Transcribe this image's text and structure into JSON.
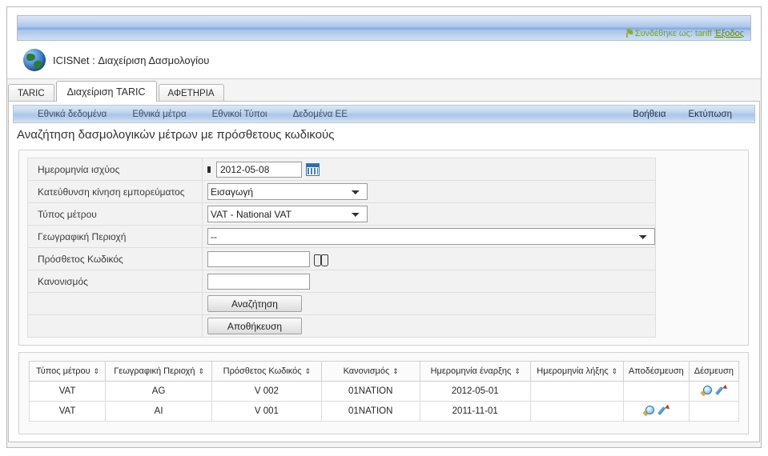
{
  "banner": {
    "login_text": "Συνδέθηκε ως: tariff",
    "logout_label": "Έξοδος",
    "app_title": "ICISNet : Διαχείριση Δασμολογίου",
    "logo_icon": "globe-icon",
    "leaf_icon": "leaf-icon"
  },
  "tabs": [
    {
      "label": "TARIC",
      "active": false
    },
    {
      "label": "Διαχείριση TARIC",
      "active": true
    },
    {
      "label": "ΑΦΕΤΗΡΙΑ",
      "active": false
    }
  ],
  "menu": {
    "left": [
      {
        "label": "Εθνικά δεδομένα"
      },
      {
        "label": "Εθνικά μέτρα"
      },
      {
        "label": "Εθνικοί Τύποι"
      },
      {
        "label": "Δεδομένα ΕΕ"
      }
    ],
    "right": [
      {
        "label": "Βοήθεια"
      },
      {
        "label": "Εκτύπωση"
      }
    ]
  },
  "page_title": "Αναζήτηση δασμολογικών μέτρων με πρόσθετους κωδικούς",
  "form": {
    "fields": [
      {
        "label": "Ημερομηνία ισχύος",
        "value": "2012-05-08",
        "required": true,
        "icon": "calendar-icon"
      },
      {
        "label": "Κατεύθυνση κίνηση εμπορεύματος",
        "value": "Εισαγωγή"
      },
      {
        "label": "Τύπος μέτρου",
        "value": "VAT - National VAT"
      },
      {
        "label": "Γεωγραφική Περιοχή",
        "value": "--"
      },
      {
        "label": "Πρόσθετος Κωδικός",
        "value": "",
        "icon": "binoculars-icon"
      },
      {
        "label": "Κανονισμός",
        "value": ""
      }
    ],
    "search_button": "Αναζήτηση",
    "save_button": "Αποθήκευση"
  },
  "results": {
    "columns": [
      {
        "label": "Τύπος μέτρου",
        "sortable": true
      },
      {
        "label": "Γεωγραφική Περιοχή",
        "sortable": true
      },
      {
        "label": "Πρόσθετος Κωδικός",
        "sortable": true
      },
      {
        "label": "Κανονισμός",
        "sortable": true
      },
      {
        "label": "Ημερομηνία έναρξης",
        "sortable": true
      },
      {
        "label": "Ημερομηνία λήξης",
        "sortable": true
      },
      {
        "label": "Αποδέσμευση",
        "sortable": false
      },
      {
        "label": "Δέσμευση",
        "sortable": false
      }
    ],
    "sort_glyph": "⇕",
    "rows": [
      {
        "measure_type": "VAT",
        "geo_area": "AG",
        "additional_code": "V 002",
        "regulation": "01NATION",
        "start_date": "2012-05-01",
        "end_date": "",
        "release_actions": [],
        "commit_actions": [
          "magnifier-icon",
          "pencil-icon"
        ]
      },
      {
        "measure_type": "VAT",
        "geo_area": "AI",
        "additional_code": "V 001",
        "regulation": "01NATION",
        "start_date": "2011-11-01",
        "end_date": "",
        "release_actions": [
          "magnifier-icon",
          "pencil-icon"
        ],
        "commit_actions": []
      }
    ]
  },
  "colors": {
    "banner_blue": "#7ea8dd",
    "menu_blue": "#a9c5e8",
    "login_green": "#7ba32a",
    "link_green": "#5e7f1b",
    "text_dark": "#2b2b2b"
  }
}
